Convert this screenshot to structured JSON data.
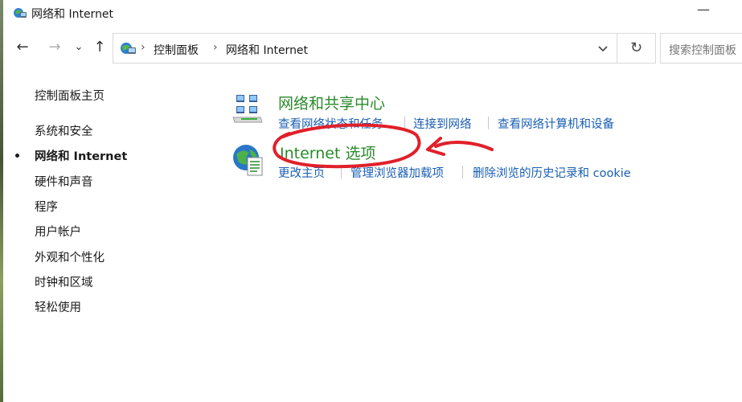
{
  "window": {
    "title": "网络和 Internet",
    "minimize_glyph": "—"
  },
  "nav": {
    "back_icon": "back-arrow-icon",
    "forward_icon": "forward-arrow-icon",
    "recent_icon": "chevron-down-icon",
    "up_icon": "up-arrow-icon",
    "back_glyph": "←",
    "forward_glyph": "→",
    "recent_glyph": "⌄",
    "up_glyph": "↑",
    "refresh_glyph": "↻"
  },
  "address": {
    "crumbs": [
      "控制面板",
      "网络和 Internet"
    ],
    "separator": "›"
  },
  "search": {
    "placeholder": "搜索控制面板"
  },
  "sidebar": {
    "home": "控制面板主页",
    "items": [
      {
        "label": "系统和安全",
        "current": false
      },
      {
        "label": "网络和 Internet",
        "current": true
      },
      {
        "label": "硬件和声音",
        "current": false
      },
      {
        "label": "程序",
        "current": false
      },
      {
        "label": "用户帐户",
        "current": false
      },
      {
        "label": "外观和个性化",
        "current": false
      },
      {
        "label": "时钟和区域",
        "current": false
      },
      {
        "label": "轻松使用",
        "current": false
      }
    ]
  },
  "categories": [
    {
      "title": "网络和共享中心",
      "icon": "network-sharing-center-icon",
      "links": [
        "查看网络状态和任务",
        "连接到网络",
        "查看网络计算机和设备"
      ]
    },
    {
      "title": "Internet 选项",
      "icon": "internet-options-icon",
      "links": [
        "更改主页",
        "管理浏览器加载项",
        "删除浏览的历史记录和 cookie"
      ]
    }
  ],
  "colors": {
    "category_title": "#2a8a2a",
    "link": "#1a5fb4",
    "annotation": "#e0202a"
  }
}
